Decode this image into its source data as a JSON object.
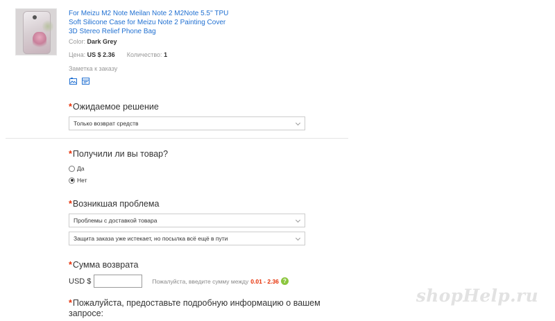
{
  "product": {
    "title": "For Meizu M2 Note Meilan Note 2 M2Note 5.5'' TPU Soft Silicone Case for Meizu Note 2 Painting Cover 3D Stereo Relief Phone Bag",
    "color_label": "Color:",
    "color_value": "Dark Grey",
    "price_label": "Цена:",
    "price_value": "US $ 2.36",
    "qty_label": "Количество:",
    "qty_value": "1",
    "note_link": "Заметка к заказу",
    "icons": [
      "snapshot-icon",
      "order-detail-icon"
    ]
  },
  "form": {
    "solution": {
      "required": "*",
      "label": "Ожидаемое решение",
      "selected": "Только возврат средств"
    },
    "received": {
      "required": "*",
      "label": "Получили ли вы товар?",
      "options": [
        {
          "label": "Да",
          "checked": false
        },
        {
          "label": "Нет",
          "checked": true
        }
      ]
    },
    "problem": {
      "required": "*",
      "label": "Возникшая проблема",
      "selected": "Проблемы с доставкой товара",
      "sub_selected": "Защита заказа уже истекает, но посылка всё ещё в пути"
    },
    "refund": {
      "required": "*",
      "label": "Сумма возврата",
      "currency": "USD $",
      "value": "",
      "hint": "Пожалуйста, введите сумму между",
      "range": "0.01 - 2.36",
      "help": "?"
    },
    "details": {
      "required": "*",
      "label_line1": "Пожалуйста, предоставьте подробную информацию о вашем",
      "label_line2": "запросе:"
    }
  },
  "watermark": "shopHelp.ru",
  "colors": {
    "link": "#1f6fd1",
    "required": "#e62e04",
    "help_badge": "#8cc63f"
  }
}
